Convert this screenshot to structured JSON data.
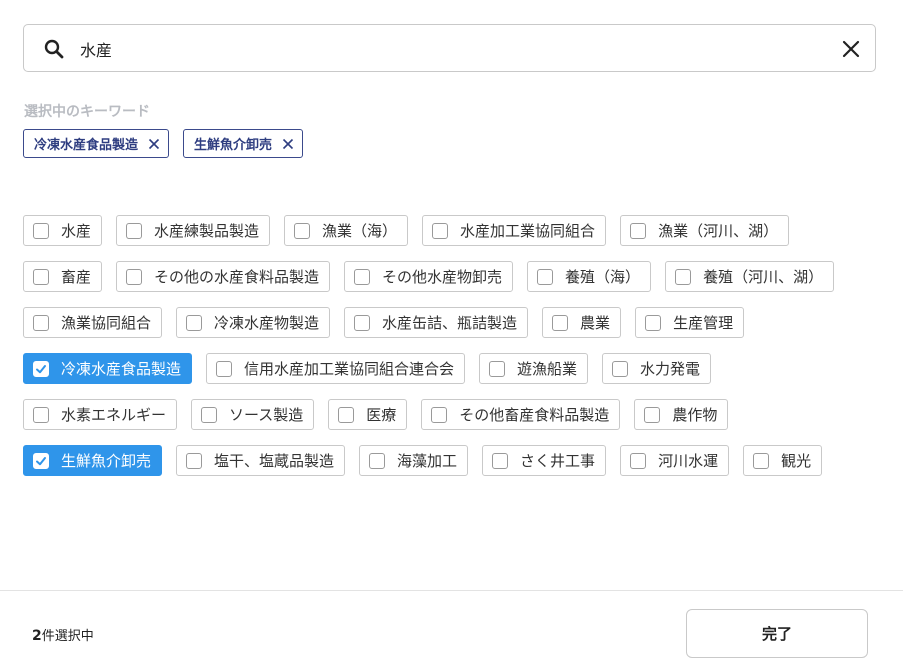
{
  "search": {
    "value": "水産",
    "placeholder": ""
  },
  "selected": {
    "heading": "選択中のキーワード",
    "chips": [
      "冷凍水産食品製造",
      "生鮮魚介卸売"
    ]
  },
  "options": [
    [
      {
        "label": "水産",
        "checked": false
      },
      {
        "label": "水産練製品製造",
        "checked": false
      },
      {
        "label": "漁業（海）",
        "checked": false
      },
      {
        "label": "水産加工業協同組合",
        "checked": false
      },
      {
        "label": "漁業（河川、湖）",
        "checked": false
      }
    ],
    [
      {
        "label": "畜産",
        "checked": false
      },
      {
        "label": "その他の水産食料品製造",
        "checked": false
      },
      {
        "label": "その他水産物卸売",
        "checked": false
      },
      {
        "label": "養殖（海）",
        "checked": false
      },
      {
        "label": "養殖（河川、湖）",
        "checked": false
      }
    ],
    [
      {
        "label": "漁業協同組合",
        "checked": false
      },
      {
        "label": "冷凍水産物製造",
        "checked": false
      },
      {
        "label": "水産缶詰、瓶詰製造",
        "checked": false
      },
      {
        "label": "農業",
        "checked": false
      },
      {
        "label": "生産管理",
        "checked": false
      }
    ],
    [
      {
        "label": "冷凍水産食品製造",
        "checked": true
      },
      {
        "label": "信用水産加工業協同組合連合会",
        "checked": false
      },
      {
        "label": "遊漁船業",
        "checked": false
      },
      {
        "label": "水力発電",
        "checked": false
      }
    ],
    [
      {
        "label": "水素エネルギー",
        "checked": false
      },
      {
        "label": "ソース製造",
        "checked": false
      },
      {
        "label": "医療",
        "checked": false
      },
      {
        "label": "その他畜産食料品製造",
        "checked": false
      },
      {
        "label": "農作物",
        "checked": false
      }
    ],
    [
      {
        "label": "生鮮魚介卸売",
        "checked": true
      },
      {
        "label": "塩干、塩蔵品製造",
        "checked": false
      },
      {
        "label": "海藻加工",
        "checked": false
      },
      {
        "label": "さく井工事",
        "checked": false
      },
      {
        "label": "河川水運",
        "checked": false
      },
      {
        "label": "観光",
        "checked": false
      }
    ]
  ],
  "footer": {
    "count": "2",
    "count_suffix": "件選択中",
    "done_label": "完了"
  },
  "colors": {
    "accent": "#2f95ea",
    "chip_selected_border": "#3b4a8c"
  }
}
